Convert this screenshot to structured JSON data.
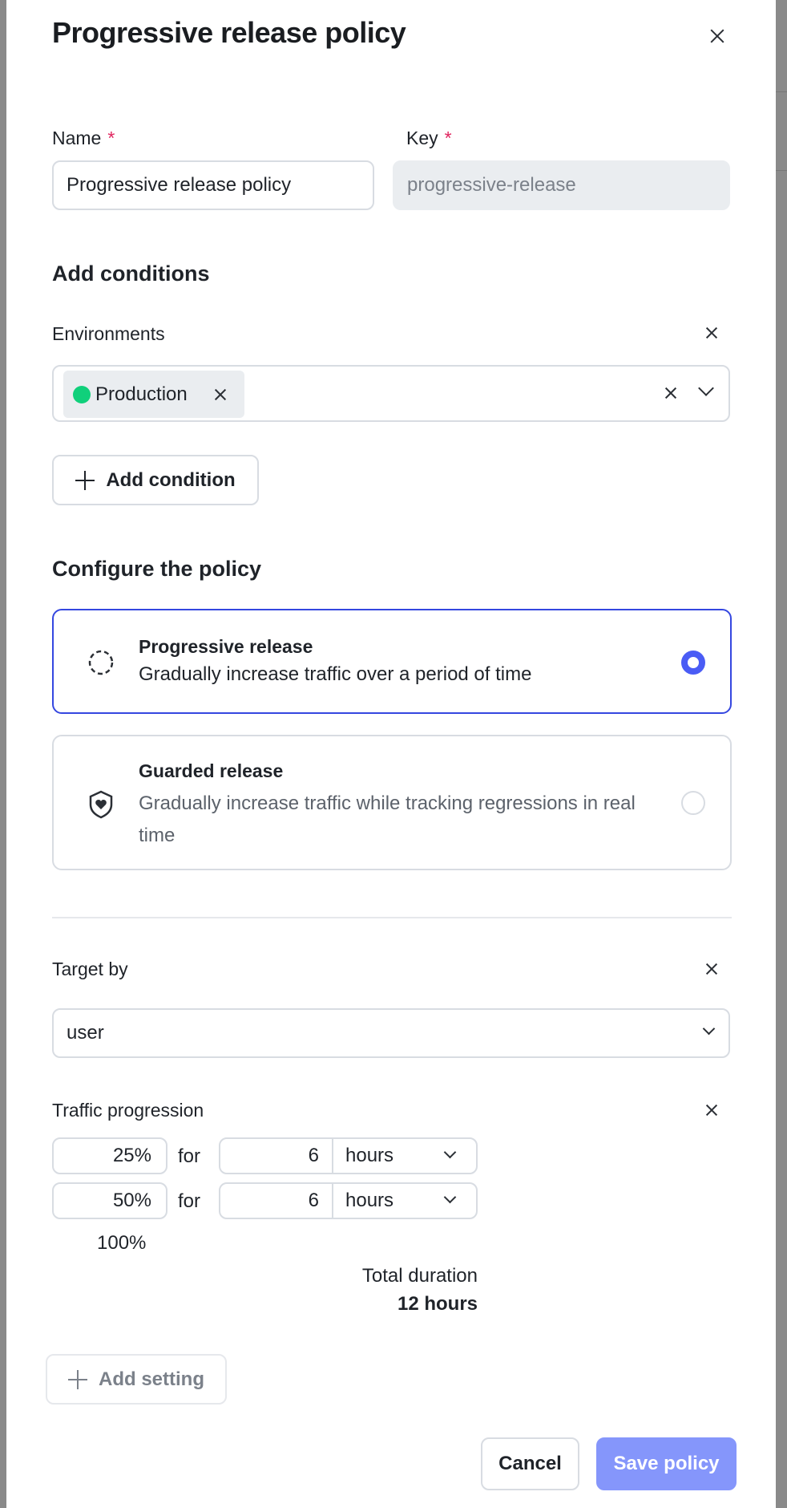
{
  "dialog": {
    "title": "Progressive release policy"
  },
  "name_field": {
    "label": "Name",
    "required": "*",
    "value": "Progressive release policy"
  },
  "key_field": {
    "label": "Key",
    "required": "*",
    "placeholder": "progressive-release"
  },
  "conditions": {
    "heading": "Add conditions",
    "environments_label": "Environments",
    "chip": "Production",
    "chip_color": "#10d07b",
    "add_condition": "Add condition"
  },
  "policy": {
    "heading": "Configure the policy",
    "options": [
      {
        "title": "Progressive release",
        "description": "Gradually increase traffic over a period of time",
        "selected": true
      },
      {
        "title": "Guarded release",
        "description": "Gradually increase traffic while tracking regressions in real time",
        "selected": false
      }
    ]
  },
  "target": {
    "label": "Target by",
    "value": "user"
  },
  "traffic": {
    "label": "Traffic progression",
    "rows": [
      {
        "percent": "25%",
        "for": "for",
        "duration": "6",
        "unit": "hours"
      },
      {
        "percent": "50%",
        "for": "for",
        "duration": "6",
        "unit": "hours"
      }
    ],
    "final": "100%",
    "total_label": "Total duration",
    "total_value": "12 hours"
  },
  "add_setting": "Add setting",
  "footer": {
    "cancel": "Cancel",
    "save": "Save policy"
  },
  "colors": {
    "accent": "#3547e0",
    "save_bg": "#8596fb"
  }
}
